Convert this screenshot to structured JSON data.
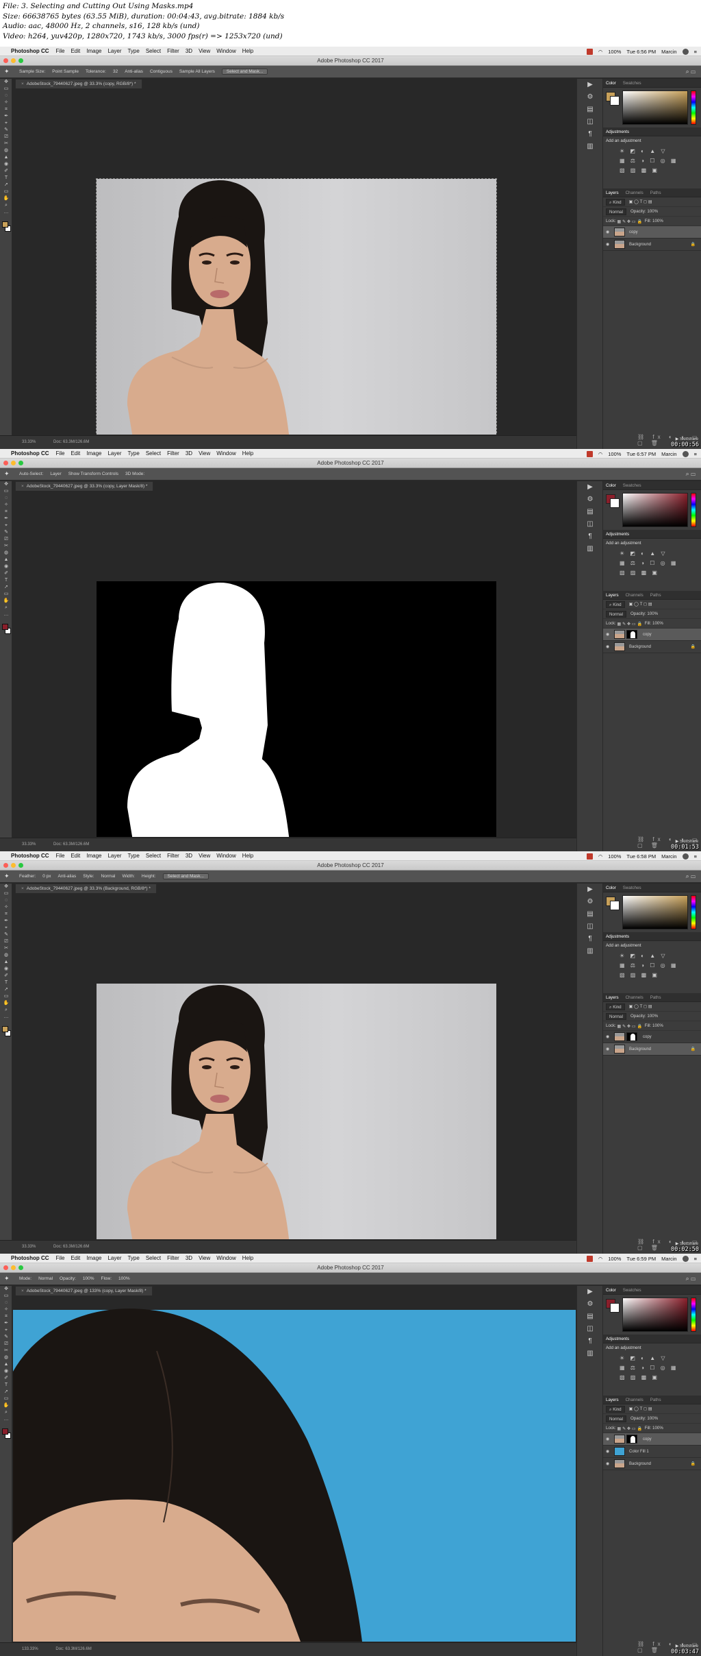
{
  "info": {
    "line1": "File: 3. Selecting and Cutting Out Using Masks.mp4",
    "line2": "Size: 66638765 bytes (63.55 MiB), duration: 00:04:43, avg.bitrate: 1884 kb/s",
    "line3": "Audio: aac, 48000 Hz, 2 channels, s16, 128 kb/s (und)",
    "line4": "Video: h264, yuv420p, 1280x720, 1743 kb/s, 3000 fps(r) => 1253x720 (und)"
  },
  "menu": {
    "app": "Photoshop CC",
    "items": [
      "File",
      "Edit",
      "Image",
      "Layer",
      "Type",
      "Select",
      "Filter",
      "3D",
      "View",
      "Window",
      "Help"
    ],
    "battery": "100%",
    "user": "Marcin"
  },
  "window_title": "Adobe Photoshop CC 2017",
  "panels": {
    "color_tabs": [
      "Color",
      "Swatches"
    ],
    "adjustments_title": "Adjustments",
    "add_adjustment": "Add an adjustment",
    "layers_tabs": [
      "Layers",
      "Channels",
      "Paths"
    ],
    "kind": "Kind",
    "blend": "Normal",
    "opacity_label": "Opacity:",
    "opacity": "100%",
    "lock_label": "Lock:",
    "fill_label": "Fill:",
    "fill": "100%"
  },
  "frames": [
    {
      "clock": "Tue 6:56 PM",
      "options": [
        "Sample Size:",
        "Point Sample",
        "Tolerance:",
        "32",
        "Anti-alias",
        "Contiguous",
        "Sample All Layers",
        "Select and Mask..."
      ],
      "doc_tab": "AdobeStock_79440627.jpeg @ 33.3% (copy, RGB/8*) *",
      "status_zoom": "33.33%",
      "status_doc": "Doc: 63.3M/126.6M",
      "layers": [
        {
          "name": "copy",
          "selected": true,
          "mask": false
        },
        {
          "name": "Background",
          "selected": false,
          "mask": false
        }
      ],
      "timestamp": "00:00:56",
      "color_fg": "#c8a15a"
    },
    {
      "clock": "Tue 6:57 PM",
      "options": [
        "Auto-Select:",
        "Layer",
        "Show Transform Controls",
        "3D Mode:"
      ],
      "doc_tab": "AdobeStock_79440627.jpeg @ 33.3% (copy, Layer Mask/8) *",
      "status_zoom": "33.33%",
      "status_doc": "Doc: 63.3M/126.6M",
      "layers": [
        {
          "name": "copy",
          "selected": true,
          "mask": true
        },
        {
          "name": "Background",
          "selected": false,
          "mask": false
        }
      ],
      "timestamp": "00:01:53",
      "color_fg": "#8a1f2b"
    },
    {
      "clock": "Tue 6:58 PM",
      "options": [
        "Feather:",
        "0 px",
        "Anti-alias",
        "Style:",
        "Normal",
        "Width:",
        "Height:",
        "Select and Mask..."
      ],
      "doc_tab": "AdobeStock_79440627.jpeg @ 33.3% (Background, RGB/8*) *",
      "status_zoom": "33.33%",
      "status_doc": "Doc: 63.3M/126.6M",
      "layers": [
        {
          "name": "copy",
          "selected": false,
          "mask": true
        },
        {
          "name": "Background",
          "selected": true,
          "mask": false
        }
      ],
      "timestamp": "00:02:50",
      "color_fg": "#c8a15a"
    },
    {
      "clock": "Tue 6:59 PM",
      "options": [
        "Mode:",
        "Normal",
        "Opacity:",
        "100%",
        "Flow:",
        "100%"
      ],
      "doc_tab": "AdobeStock_79440627.jpeg @ 133% (copy, Layer Mask/8) *",
      "status_zoom": "133.33%",
      "status_doc": "Doc: 63.3M/126.6M",
      "layers": [
        {
          "name": "copy",
          "selected": true,
          "mask": true
        },
        {
          "name": "Color Fill 1",
          "selected": false,
          "mask": false
        },
        {
          "name": "Background",
          "selected": false,
          "mask": false
        }
      ],
      "timestamp": "00:03:47",
      "color_fg": "#8a1f2b"
    }
  ],
  "colors": {
    "ps_bg": "#282828",
    "panel": "#3c3c3c",
    "studio_gray": "#cfcfd1",
    "cyan_fill": "#3fa3d4",
    "hair": "#1a1512",
    "skin": "#d8ab8d"
  }
}
